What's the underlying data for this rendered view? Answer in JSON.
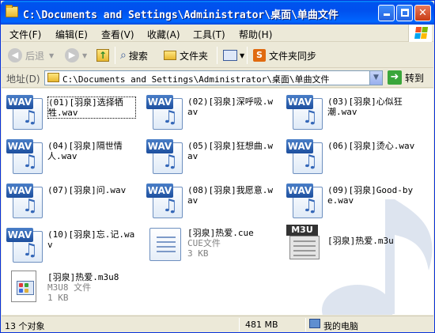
{
  "window": {
    "title": "C:\\Documents and Settings\\Administrator\\桌面\\单曲文件",
    "controls": {
      "minimize": "",
      "maximize": "",
      "close": "✕"
    }
  },
  "menu": {
    "items": [
      "文件(F)",
      "编辑(E)",
      "查看(V)",
      "收藏(A)",
      "工具(T)",
      "帮助(H)"
    ]
  },
  "toolbar": {
    "back": "后退",
    "search": "搜索",
    "folders": "文件夹",
    "sync": "文件夹同步"
  },
  "address": {
    "label": "地址(D)",
    "path": "C:\\Documents and Settings\\Administrator\\桌面\\单曲文件",
    "go": "转到"
  },
  "files": [
    {
      "type": "wav",
      "badge": "WAV",
      "name": "(01)[羽泉]选择牺牲.wav",
      "selected": true
    },
    {
      "type": "wav",
      "badge": "WAV",
      "name": "(02)[羽泉]深呼吸.wav"
    },
    {
      "type": "wav",
      "badge": "WAV",
      "name": "(03)[羽泉]心似狂潮.wav"
    },
    {
      "type": "wav",
      "badge": "WAV",
      "name": "(04)[羽泉]隔世情人.wav"
    },
    {
      "type": "wav",
      "badge": "WAV",
      "name": "(05)[羽泉]狂想曲.wav"
    },
    {
      "type": "wav",
      "badge": "WAV",
      "name": "(06)[羽泉]烫心.wav"
    },
    {
      "type": "wav",
      "badge": "WAV",
      "name": "(07)[羽泉]问.wav"
    },
    {
      "type": "wav",
      "badge": "WAV",
      "name": "(08)[羽泉]我愿意.wav"
    },
    {
      "type": "wav",
      "badge": "WAV",
      "name": "(09)[羽泉]Good-bye.wav"
    },
    {
      "type": "wav",
      "badge": "WAV",
      "name": "(10)[羽泉]忘.记.wav"
    },
    {
      "type": "cue",
      "name": "[羽泉]热爱.cue",
      "kind": "CUE文件",
      "size": "3 KB"
    },
    {
      "type": "m3u",
      "badge": "M3U",
      "name": "[羽泉]热爱.m3u"
    },
    {
      "type": "m3u8",
      "name": "[羽泉]热爱.m3u8",
      "kind": "M3U8 文件",
      "size": "1 KB"
    }
  ],
  "status": {
    "count": "13 个对象",
    "size": "481 MB",
    "location": "我的电脑"
  }
}
